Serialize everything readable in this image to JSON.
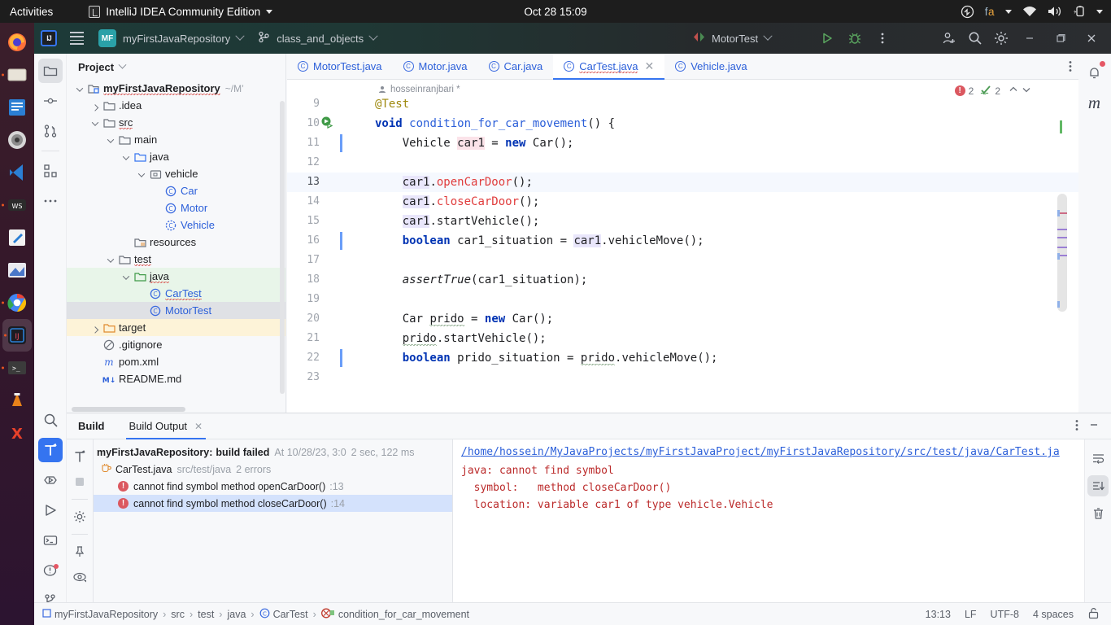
{
  "os_bar": {
    "activities": "Activities",
    "app_name": "IntelliJ IDEA Community Edition",
    "clock": "Oct 28  15:09",
    "language": "fa",
    "icons": [
      "accessibility-icon",
      "wifi-icon",
      "volume-icon",
      "battery-icon",
      "chevron-down-icon"
    ]
  },
  "dock": {
    "items": [
      {
        "name": "firefox",
        "running": false
      },
      {
        "name": "files",
        "running": true
      },
      {
        "name": "text-editor",
        "running": false
      },
      {
        "name": "settings-disc",
        "running": false
      },
      {
        "name": "vscode",
        "running": false
      },
      {
        "name": "webstorm",
        "running": true
      },
      {
        "name": "notes",
        "running": false
      },
      {
        "name": "paint",
        "running": false
      },
      {
        "name": "chrome",
        "running": true
      },
      {
        "name": "intellij-idea",
        "running": true,
        "active": true
      },
      {
        "name": "terminal",
        "running": true
      },
      {
        "name": "vlc",
        "running": false
      },
      {
        "name": "xampp",
        "running": false
      }
    ],
    "show_apps": "show-applications"
  },
  "toolbar": {
    "logo": "IJ",
    "menu_label": "main-menu",
    "project_badge": "MF",
    "project_name": "myFirstJavaRepository",
    "branch_name": "class_and_objects",
    "run_config": "MotorTest",
    "run_label": "Run",
    "debug_label": "Debug",
    "more_label": "More actions",
    "code_with_me": "Code With Me",
    "search_label": "Search Everywhere",
    "settings_label": "Settings",
    "minimize": "—",
    "maximize": "□",
    "close": "✕"
  },
  "left_strip": {
    "top_items": [
      {
        "name": "project",
        "selected": true
      },
      {
        "name": "commit",
        "selected": false
      },
      {
        "name": "pull-requests",
        "selected": false
      },
      {
        "name": "structure",
        "selected": false
      },
      {
        "name": "more-tool-windows",
        "selected": false
      }
    ],
    "bottom_items": [
      {
        "name": "find",
        "selected": false
      },
      {
        "name": "build",
        "selected": true
      },
      {
        "name": "run-anything",
        "selected": false
      },
      {
        "name": "run",
        "selected": false
      },
      {
        "name": "terminal",
        "selected": false
      },
      {
        "name": "problems",
        "selected": false,
        "badge": true
      },
      {
        "name": "version-control",
        "selected": false
      }
    ]
  },
  "right_strip": {
    "items": [
      {
        "name": "notifications",
        "badge": true
      },
      {
        "name": "maven"
      }
    ]
  },
  "project_panel": {
    "title": "Project",
    "tree": [
      {
        "depth": 0,
        "toggle": "down",
        "icon": "module-icon",
        "label": "myFirstJavaRepository",
        "style": "bold-squiggle",
        "suffix": "~/M’",
        "row": "none"
      },
      {
        "depth": 1,
        "toggle": "right",
        "icon": "folder-icon",
        "label": ".idea",
        "style": "plain",
        "row": "none"
      },
      {
        "depth": 1,
        "toggle": "down",
        "icon": "folder-icon",
        "label": "src",
        "style": "squiggle",
        "row": "none"
      },
      {
        "depth": 2,
        "toggle": "down",
        "icon": "folder-icon",
        "label": "main",
        "style": "plain",
        "row": "none"
      },
      {
        "depth": 3,
        "toggle": "down",
        "icon": "source-root-icon",
        "label": "java",
        "style": "plain",
        "row": "none"
      },
      {
        "depth": 4,
        "toggle": "down",
        "icon": "package-icon",
        "label": "vehicle",
        "style": "plain",
        "row": "none"
      },
      {
        "depth": 5,
        "toggle": "none",
        "icon": "class-icon",
        "label": "Car",
        "style": "blue",
        "row": "none"
      },
      {
        "depth": 5,
        "toggle": "none",
        "icon": "class-icon",
        "label": "Motor",
        "style": "blue",
        "row": "none"
      },
      {
        "depth": 5,
        "toggle": "none",
        "icon": "interface-icon",
        "label": "Vehicle",
        "style": "blue",
        "row": "none"
      },
      {
        "depth": 3,
        "toggle": "none",
        "icon": "resource-root-icon",
        "label": "resources",
        "style": "plain",
        "row": "none"
      },
      {
        "depth": 2,
        "toggle": "down",
        "icon": "folder-icon",
        "label": "test",
        "style": "squiggle",
        "row": "none"
      },
      {
        "depth": 3,
        "toggle": "down",
        "icon": "test-root-icon",
        "label": "java",
        "style": "squiggle",
        "row": "green"
      },
      {
        "depth": 4,
        "toggle": "none",
        "icon": "class-icon",
        "label": "CarTest",
        "style": "blue-squiggle",
        "row": "green"
      },
      {
        "depth": 4,
        "toggle": "none",
        "icon": "class-icon",
        "label": "MotorTest",
        "style": "blue",
        "row": "selected"
      },
      {
        "depth": 1,
        "toggle": "right",
        "icon": "excluded-folder-icon",
        "label": "target",
        "style": "plain",
        "row": "amber"
      },
      {
        "depth": 1,
        "toggle": "none",
        "icon": "gitignore-icon",
        "label": ".gitignore",
        "style": "plain",
        "row": "none"
      },
      {
        "depth": 1,
        "toggle": "none",
        "icon": "maven-icon",
        "label": "pom.xml",
        "style": "plain",
        "row": "none"
      },
      {
        "depth": 1,
        "toggle": "none",
        "icon": "markdown-icon",
        "label": "README.md",
        "style": "plain",
        "row": "none"
      }
    ]
  },
  "editor": {
    "tabs": [
      {
        "label": "MotorTest.java",
        "active": false,
        "closable": false
      },
      {
        "label": "Motor.java",
        "active": false,
        "closable": false
      },
      {
        "label": "Car.java",
        "active": false,
        "closable": false
      },
      {
        "label": "CarTest.java",
        "active": true,
        "closable": true
      },
      {
        "label": "Vehicle.java",
        "active": false,
        "closable": false
      }
    ],
    "tab_options_label": "options",
    "vcs_hint": "hosseinranjbari *",
    "inspections": {
      "error_count": "2",
      "warning_count": "2",
      "up_label": "previous-highlight",
      "down_label": "next-highlight"
    },
    "first_line_number": 9,
    "current_line": 13,
    "lines": [
      {
        "n": 9,
        "text": "@Test",
        "changed": false
      },
      {
        "n": 10,
        "text": "void condition_for_car_movement() {",
        "changed": false,
        "gutter_icon": "run-test-icon"
      },
      {
        "n": 11,
        "text": "    Vehicle car1 = new Car();",
        "changed": true
      },
      {
        "n": 12,
        "text": "",
        "changed": false
      },
      {
        "n": 13,
        "text": "    car1.openCarDoor();",
        "changed": false
      },
      {
        "n": 14,
        "text": "    car1.closeCarDoor();",
        "changed": false
      },
      {
        "n": 15,
        "text": "    car1.startVehicle();",
        "changed": false
      },
      {
        "n": 16,
        "text": "    boolean car1_situation = car1.vehicleMove();",
        "changed": true
      },
      {
        "n": 17,
        "text": "",
        "changed": false
      },
      {
        "n": 18,
        "text": "    assertTrue(car1_situation);",
        "changed": false
      },
      {
        "n": 19,
        "text": "",
        "changed": false
      },
      {
        "n": 20,
        "text": "    Car prido = new Car();",
        "changed": false
      },
      {
        "n": 21,
        "text": "    prido.startVehicle();",
        "changed": false
      },
      {
        "n": 22,
        "text": "    boolean prido_situation = prido.vehicleMove();",
        "changed": true
      },
      {
        "n": 23,
        "text": "",
        "changed": false
      }
    ]
  },
  "build_window": {
    "title": "Build",
    "tab_label": "Build Output",
    "tab_close": "✕",
    "options_label": "options",
    "minimize_label": "—",
    "side_buttons": [
      "rerun-build-icon",
      "stop-icon",
      "settings-icon",
      "pin-icon",
      "eye-icon"
    ],
    "console_buttons": [
      "soft-wrap-icon",
      "scroll-to-end-icon",
      "trash-icon"
    ],
    "tree": [
      {
        "kind": "summary",
        "title": "myFirstJavaRepository:",
        "status": "build failed",
        "time": "At 10/28/23, 3:0",
        "duration": "2 sec, 122 ms"
      },
      {
        "kind": "file",
        "label": "CarTest.java",
        "path": "src/test/java",
        "errors": "2 errors"
      },
      {
        "kind": "error",
        "label": "cannot find symbol method openCarDoor()",
        "line": ":13",
        "selected": false
      },
      {
        "kind": "error",
        "label": "cannot find symbol method closeCarDoor()",
        "line": ":14",
        "selected": true
      }
    ],
    "console": {
      "link": "/home/hossein/MyJavaProjects/myFirstJavaProject/myFirstJavaRepository/src/test/java/CarTest.ja",
      "lines": [
        "java: cannot find symbol",
        "  symbol:   method closeCarDoor()",
        "  location: variable car1 of type vehicle.Vehicle"
      ]
    }
  },
  "status_bar": {
    "breadcrumbs": [
      "myFirstJavaRepository",
      "src",
      "test",
      "java",
      "CarTest",
      "condition_for_car_movement"
    ],
    "separator": "›",
    "caret_position": "13:13",
    "line_separator": "LF",
    "encoding": "UTF-8",
    "indent": "4 spaces",
    "lock_label": "read-only-toggle",
    "menu_label": "show-applications"
  },
  "colors": {
    "accent": "#3574f0",
    "error": "#db5860",
    "link": "#2b5fd9",
    "keyword": "#0033b3",
    "annotation": "#9e880d",
    "dock_bg": "#2c1430",
    "toolbar_bg": "#2b2d30"
  }
}
